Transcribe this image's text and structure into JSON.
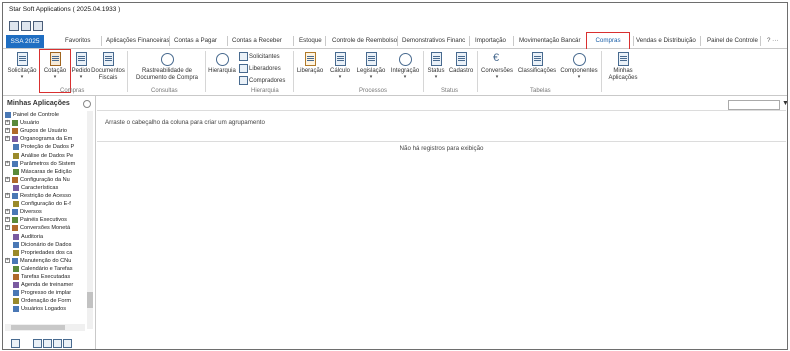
{
  "window": {
    "title": "Star Soft Applications ( 2025.04.1933 )"
  },
  "tabs": {
    "ssa": "SSA 2025",
    "items": [
      "Favoritos",
      "Aplicações Financeiras",
      "Contas a Pagar",
      "Contas a Receber",
      "Estoque",
      "Controle de Reembolso",
      "Demonstrativos Financ",
      "Importação",
      "Movimentação Bancár",
      "Compras",
      "Vendas e Distribuição",
      "Painel de Controle"
    ],
    "help": "? ···"
  },
  "ribbon": {
    "buttons": {
      "solicitacao": "Solicitação",
      "cotacao": "Cotação",
      "pedido": "Pedido",
      "documentos_fiscais": "Documentos\nFiscais",
      "rastreabilidade": "Rastreabilidade de\nDocumento de Compra",
      "hierarquia": "Hierarquia",
      "solicitantes": "Solicitantes",
      "liberadores": "Liberadores",
      "compradores": "Compradores",
      "liberacao": "Liberação",
      "calculo": "Cálculo",
      "legislacao": "Legislação",
      "integracao": "Integração",
      "status": "Status",
      "cadastro": "Cadastro",
      "conversoes": "Conversões",
      "classificacoes": "Classificações",
      "componentes": "Componentes",
      "minhas_aplicacoes": "Minhas\nAplicações"
    },
    "groups": {
      "compras": "Compras",
      "consultas": "Consultas",
      "hierarquia": "Hierarquia",
      "processos": "Processos",
      "status": "Status",
      "tabelas": "Tabelas"
    }
  },
  "sidebar": {
    "title": "Minhas Aplicações",
    "items": [
      "Painel de Controle",
      "Usuário",
      "Grupos de Usuário",
      "Organograma da Em",
      "Proteção de Dados P",
      "Análise de Dados Pe",
      "Parâmetros do Sistem",
      "Máscaras de Edição",
      "Configuração da Nu",
      "Características",
      "Restrição de Acesso",
      "Configuração do E-f",
      "Diversos",
      "Painéis Executivos",
      "Conversões Monetá",
      "Auditoria",
      "Dicionário de Dados",
      "Propriedades dos ca",
      "Manutenção do CNu",
      "Calendário e Tarefas",
      "Tarefas Executadas",
      "Agenda de treinamer",
      "Progresso de implar",
      "Ordenação de Form",
      "Usuários Logados"
    ]
  },
  "main": {
    "group_hint": "Arraste o cabeçalho da coluna para criar um agrupamento",
    "empty": "Não há registros para exibição"
  },
  "accent": "#1f6ec2",
  "highlight": "#d93030"
}
